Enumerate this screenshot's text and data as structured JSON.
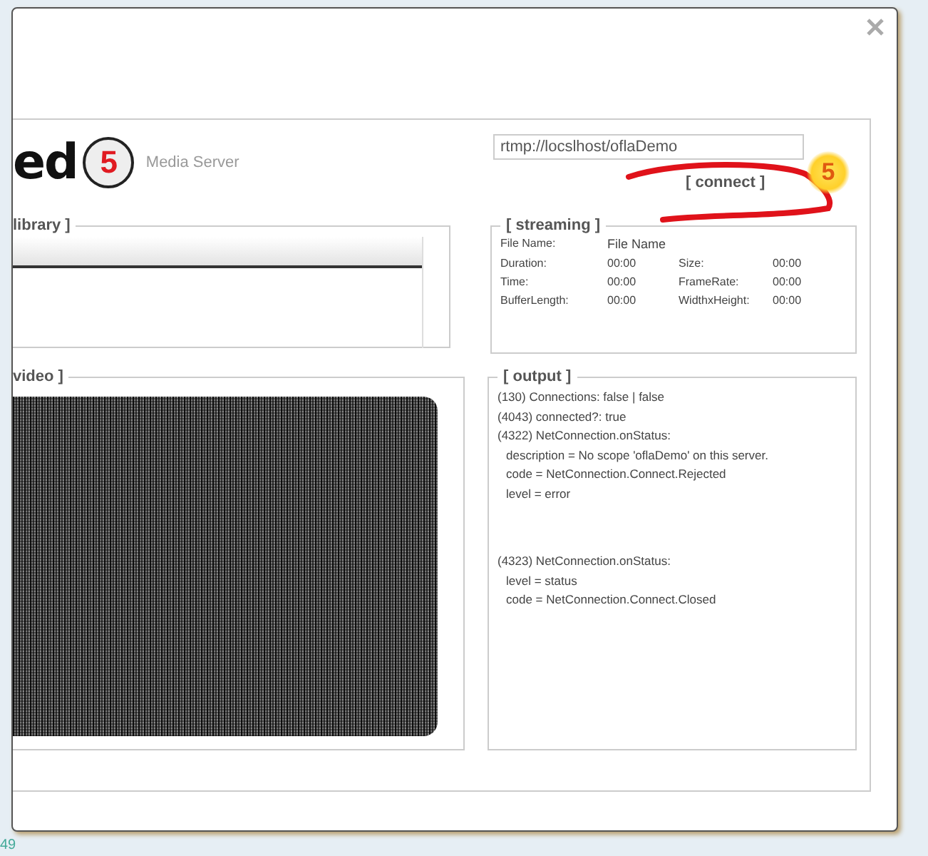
{
  "header": {
    "logo_text": "ed",
    "logo_mark": "5",
    "subtitle": "Media Server",
    "url_field": {
      "value": "rtmp://locslhost/oflaDemo"
    },
    "connect_link": "[ connect ]",
    "annotation_badge": "5"
  },
  "library": {
    "legend": "library ]"
  },
  "streaming": {
    "legend": "[ streaming ]",
    "file_label": "File Name:",
    "file_value": "File Name",
    "fields": [
      {
        "label": "Duration:",
        "value": "00:00"
      },
      {
        "label": "Size:",
        "value": "00:00"
      },
      {
        "label": "Time:",
        "value": "00:00"
      },
      {
        "label": "FrameRate:",
        "value": "00:00"
      },
      {
        "label": "BufferLength:",
        "value": "00:00"
      },
      {
        "label": "WidthxHeight:",
        "value": "00:00"
      }
    ]
  },
  "video": {
    "legend": "video ]"
  },
  "output": {
    "legend": "[ output ]",
    "entries": [
      {
        "lines": [
          {
            "kind": "event",
            "text": "(130) Connections: false | false"
          },
          {
            "kind": "event",
            "text": "(4043) connected?: true"
          },
          {
            "kind": "event",
            "text": "(4322) NetConnection.onStatus:"
          },
          {
            "kind": "detail",
            "text": "description = No scope 'oflaDemo' on this server."
          },
          {
            "kind": "detail",
            "text": "code = NetConnection.Connect.Rejected"
          },
          {
            "kind": "detail",
            "text": "level = error"
          }
        ]
      },
      {
        "lines": [
          {
            "kind": "event",
            "text": "(4323) NetConnection.onStatus:"
          },
          {
            "kind": "detail",
            "text": "level = status"
          },
          {
            "kind": "detail",
            "text": "code = NetConnection.Connect.Closed"
          }
        ]
      }
    ]
  },
  "page_footer": "49"
}
